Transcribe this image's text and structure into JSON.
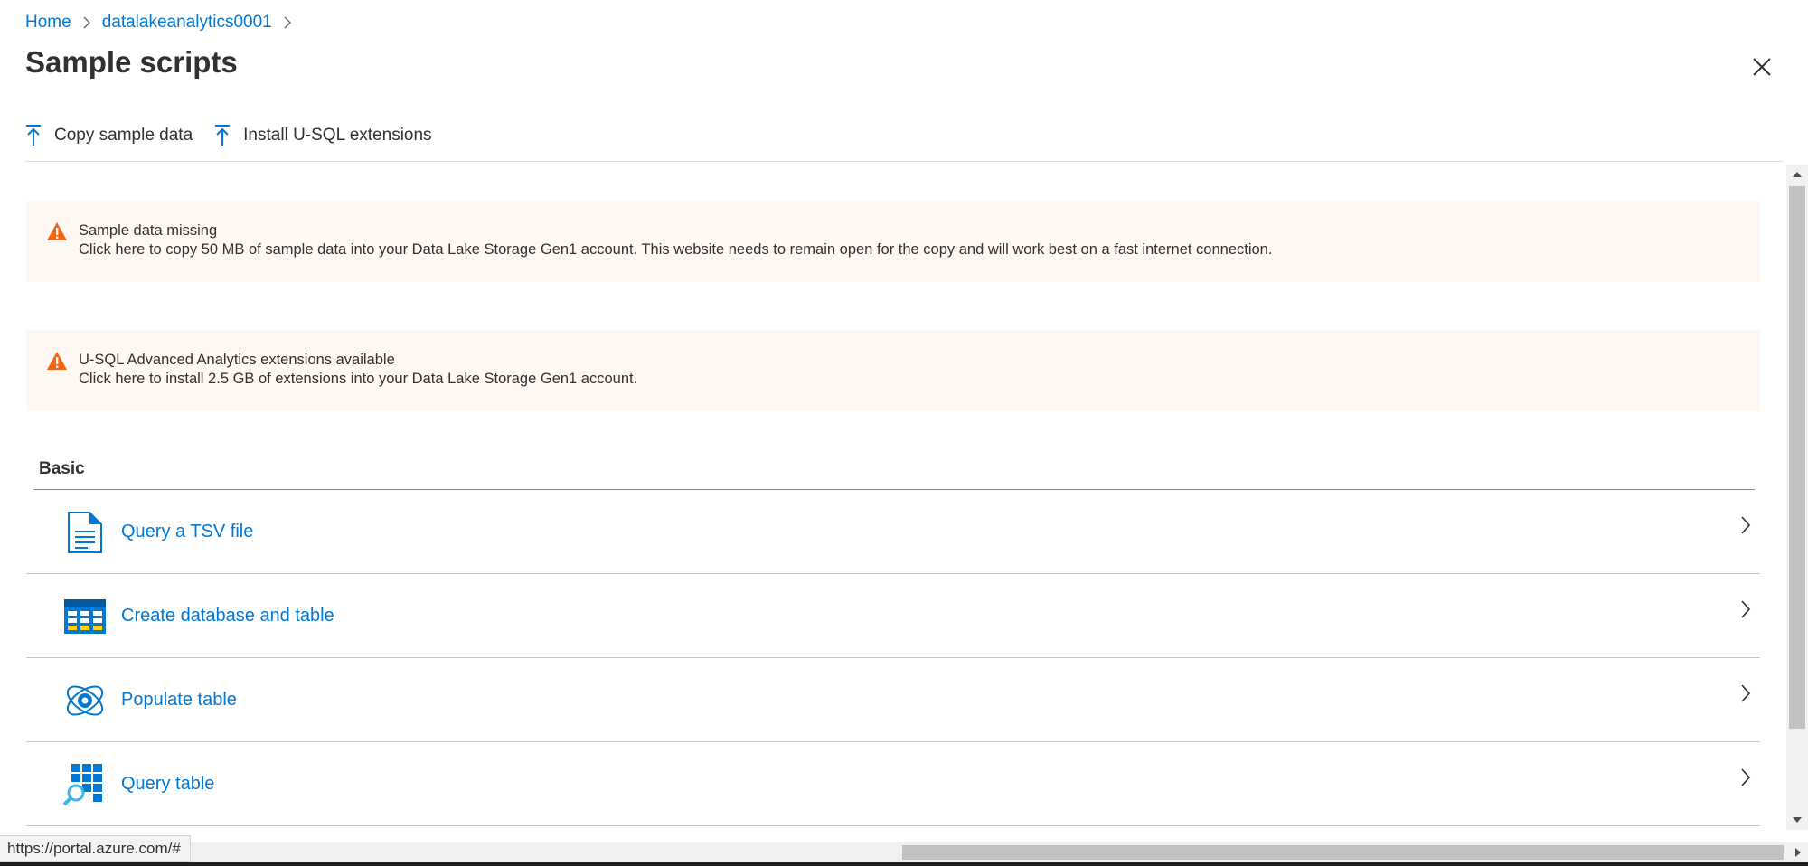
{
  "breadcrumb": {
    "items": [
      {
        "label": "Home"
      },
      {
        "label": "datalakeanalytics0001"
      }
    ]
  },
  "panel": {
    "title": "Sample scripts"
  },
  "toolbar": {
    "copy_label": "Copy sample data",
    "install_label": "Install U-SQL extensions"
  },
  "banners": [
    {
      "title": "Sample data missing",
      "description": "Click here to copy 50 MB of sample data into your Data Lake Storage Gen1 account. This website needs to remain open for the copy and will work best on a fast internet connection."
    },
    {
      "title": "U-SQL Advanced Analytics extensions available",
      "description": "Click here to install 2.5 GB of extensions into your Data Lake Storage Gen1 account."
    }
  ],
  "section": {
    "title": "Basic",
    "items": [
      {
        "label": "Query a TSV file",
        "icon": "document-icon"
      },
      {
        "label": "Create database and table",
        "icon": "table-icon"
      },
      {
        "label": "Populate table",
        "icon": "orbit-icon"
      },
      {
        "label": "Query table",
        "icon": "grid-search-icon"
      }
    ]
  },
  "status": {
    "url": "https://portal.azure.com/#"
  },
  "colors": {
    "accent": "#0078d4",
    "warning": "#f7630c",
    "banner_bg": "#fff7f2"
  }
}
